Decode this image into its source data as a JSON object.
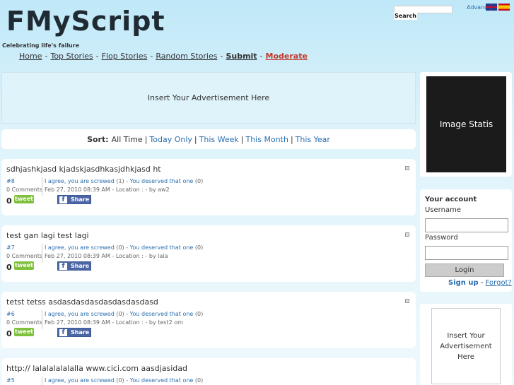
{
  "header": {
    "logo": "FMyScript",
    "tagline": "Celebrating life's failure",
    "search_button": "Search",
    "advanced_link": "Advanced Search"
  },
  "nav": {
    "items": [
      {
        "label": "Home"
      },
      {
        "label": "Top Stories"
      },
      {
        "label": "Flop Stories"
      },
      {
        "label": "Random Stories"
      },
      {
        "label": "Submit"
      },
      {
        "label": "Moderate"
      }
    ],
    "separator": "-"
  },
  "ad_banner": {
    "text": "Insert Your Advertisement Here"
  },
  "sort": {
    "label": "Sort:",
    "options": [
      "All Time",
      "Today Only",
      "This Week",
      "This Month",
      "This Year"
    ],
    "separator": "|"
  },
  "stories": [
    {
      "title": "sdhjashkjasd kjadskjasdhkasjdhkjasd ht",
      "number": "#8",
      "comments": "0 Comments",
      "agree_label": "I agree, you are screwed",
      "agree_count": "(1)",
      "deserved_label": "You deserved that one",
      "deserved_count": "(0)",
      "meta": "Feb 27, 2010 08:39 AM - Location : - by aw2",
      "score": "0",
      "tweet": "tweet",
      "share": "Share"
    },
    {
      "title": "test gan lagi test lagi",
      "number": "#7",
      "comments": "0 Comments",
      "agree_label": "I agree, you are screwed",
      "agree_count": "(0)",
      "deserved_label": "You deserved that one",
      "deserved_count": "(0)",
      "meta": "Feb 27, 2010 08:39 AM - Location : - by lala",
      "score": "0",
      "tweet": "tweet",
      "share": "Share"
    },
    {
      "title": "tetst tetss asdasdasdasdasdasdasdasd",
      "number": "#6",
      "comments": "0 Comments",
      "agree_label": "I agree, you are screwed",
      "agree_count": "(0)",
      "deserved_label": "You deserved that one",
      "deserved_count": "(0)",
      "meta": "Feb 27, 2010 08:39 AM - Location : - by test2 om",
      "score": "0",
      "tweet": "tweet",
      "share": "Share"
    },
    {
      "title": "http:// lalalalalalalla www.cici.com aasdjasidad",
      "number": "#5",
      "comments": "",
      "agree_label": "I agree, you are screwed",
      "agree_count": "(0)",
      "deserved_label": "You deserved that one",
      "deserved_count": "(0)",
      "meta": "",
      "score": "",
      "tweet": "",
      "share": ""
    }
  ],
  "sidebar": {
    "image_text": "Image Statis",
    "account": {
      "heading": "Your account",
      "username_label": "Username",
      "password_label": "Password",
      "login_button": "Login",
      "signup_link": "Sign up",
      "separator": "-",
      "forgot_link": "Forgot?"
    },
    "ad_text": "Insert Your Advertisement Here"
  },
  "colors": {
    "link": "#2a6fb0",
    "moderate": "#c0392b",
    "tweet": "#7fc13c",
    "facebook": "#4c66a4"
  }
}
